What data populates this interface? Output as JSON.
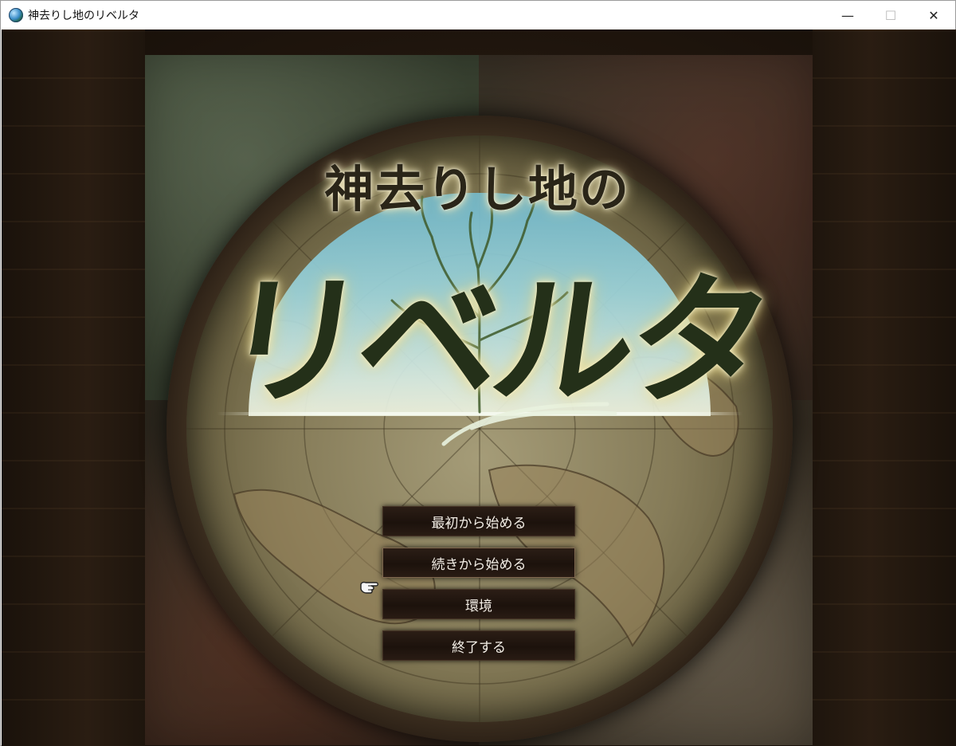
{
  "window": {
    "title": "神去りし地のリベルタ",
    "controls": {
      "minimize": "—",
      "maximize": "☐",
      "close": "✕"
    }
  },
  "logo": {
    "subtitle": "神去りし地の",
    "title": "リベルタ"
  },
  "menu": {
    "items": [
      {
        "label": "最初から始める"
      },
      {
        "label": "続きから始める"
      },
      {
        "label": "環境"
      },
      {
        "label": "終了する"
      }
    ],
    "selected_index": 1
  },
  "icons": {
    "app": "globe-icon",
    "cursor": "pointing-hand-icon"
  },
  "colors": {
    "menu_button_bg": "#1c120c",
    "menu_text": "#f3eee6",
    "frame": "#23180f"
  }
}
